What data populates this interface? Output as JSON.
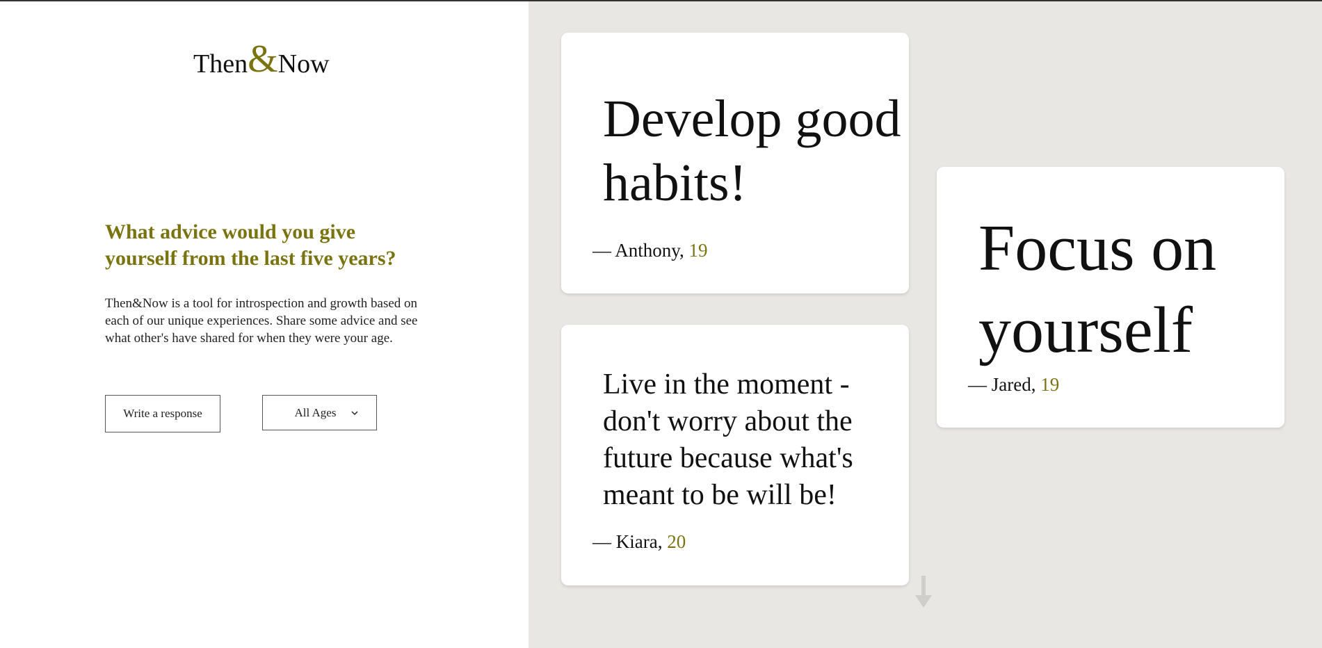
{
  "logo": {
    "then": "Then",
    "amp": "&",
    "now": "Now"
  },
  "intro": {
    "question": "What advice would you give yourself from the last five years?",
    "description": "Then&Now is a tool for introspection and growth based on each of our unique experiences. Share some advice and see what other's have shared for when they were your age."
  },
  "controls": {
    "write_label": "Write a response",
    "age_filter": "All Ages"
  },
  "cards": [
    {
      "quote": "Develop good habits!",
      "dash": "—",
      "name": "Anthony,",
      "age": "19"
    },
    {
      "quote": "Focus on yourself",
      "dash": "—",
      "name": "Jared,",
      "age": "19"
    },
    {
      "quote": "Live in the moment - don't worry about the future because what's meant to be will be!",
      "dash": "—",
      "name": "Kiara,",
      "age": "20"
    }
  ],
  "colors": {
    "accent": "#7a7410",
    "right_bg": "#e8e7e4",
    "card_bg": "#ffffff"
  },
  "icons": {
    "select": "chevron-down-icon",
    "scroll": "arrow-down-icon"
  }
}
